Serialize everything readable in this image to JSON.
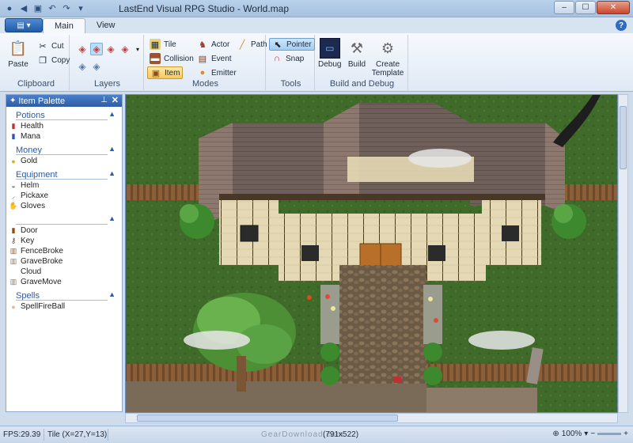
{
  "window": {
    "title": "LastEnd Visual RPG Studio - World.map",
    "minimize": "–",
    "maximize": "☐",
    "close": "✕"
  },
  "ribbon": {
    "app_button": "▤ ▾",
    "tabs": [
      "Main",
      "View"
    ],
    "help": "?",
    "clipboard": {
      "label": "Clipboard",
      "paste": "Paste",
      "cut": "Cut",
      "copy": "Copy"
    },
    "layers": {
      "label": "Layers"
    },
    "modes": {
      "label": "Modes",
      "tile": "Tile",
      "collision": "Collision",
      "item": "Item",
      "actor": "Actor",
      "event": "Event",
      "emitter": "Emitter",
      "path": "Path"
    },
    "tools": {
      "label": "Tools",
      "pointer": "Pointer",
      "snap": "Snap"
    },
    "build": {
      "label": "Build and Debug",
      "debug": "Debug",
      "build": "Build",
      "create_template": "Create Template"
    }
  },
  "palette": {
    "title": "Item Palette",
    "sections": [
      {
        "name": "Potions",
        "items": [
          "Health",
          "Mana"
        ]
      },
      {
        "name": "Money",
        "items": [
          "Gold"
        ]
      },
      {
        "name": "Equipment",
        "items": [
          "Helm",
          "Pickaxe",
          "Gloves"
        ]
      },
      {
        "name": "",
        "items": [
          "Door",
          "Key",
          "FenceBroke",
          "GraveBroke",
          "Cloud",
          "GraveMove"
        ]
      },
      {
        "name": "Spells",
        "items": [
          "SpellFireBall"
        ]
      }
    ]
  },
  "status": {
    "fps": "FPS:29.39",
    "tile": "Tile (X=27,Y=13)",
    "size": "(791x522)",
    "watermark": "GearDownload.com",
    "zoom": "100%"
  },
  "colors": {
    "grass": "#3f6a2a",
    "roof": "#6f5f5a",
    "path": "#6b5a45",
    "accent": "#2d5da5"
  }
}
